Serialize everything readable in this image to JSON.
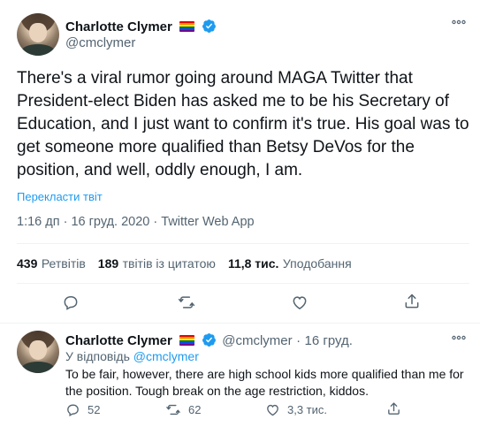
{
  "main_tweet": {
    "author_name": "Charlotte Clymer",
    "author_handle": "@cmclymer",
    "text": "There's a viral rumor going around MAGA Twitter that President-elect Biden has asked me to be his Secretary of Education, and I just want to confirm it's true. His goal was to get someone more qualified than Betsy DeVos for the position, and well, oddly enough, I am.",
    "translate_label": "Перекласти твіт",
    "time": "1:16 дп",
    "date": "16 груд. 2020",
    "source": "Twitter Web App",
    "sep": "·",
    "stats": {
      "retweets_count": "439",
      "retweets_label": "Ретвітів",
      "quotes_count": "189",
      "quotes_label": "твітів із цитатою",
      "likes_count": "11,8 тис.",
      "likes_label": "Уподобання"
    }
  },
  "reply_tweet": {
    "author_name": "Charlotte Clymer",
    "author_handle": "@cmclymer",
    "sep": "·",
    "date": "16 груд.",
    "reply_prefix": "У відповідь",
    "reply_mention": "@cmclymer",
    "text": "To be fair, however, there are high school kids more qualified than me for the position. Tough break on the age restriction, kiddos.",
    "replies": "52",
    "retweets": "62",
    "likes": "3,3 тис."
  },
  "colors": {
    "accent": "#1d9bf0",
    "muted": "#536471",
    "text": "#0f1419",
    "divider": "#eff3f4"
  },
  "icons": [
    "more-icon",
    "verified-icon",
    "pride-flag-icon",
    "reply-icon",
    "retweet-icon",
    "like-icon",
    "share-icon"
  ]
}
